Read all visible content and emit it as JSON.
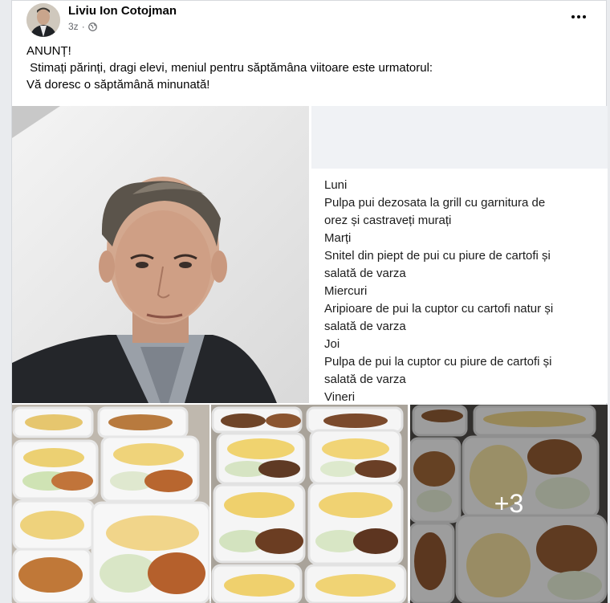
{
  "post": {
    "author": "Liviu Ion Cotojman",
    "time": "3z",
    "privacy_icon": "globe-icon",
    "text_lines": [
      "ANUNȚ!",
      " Stimați părinți, dragi elevi, meniul pentru săptămâna viitoare este urmatorul:",
      "Vă doresc o săptămână minunată!"
    ]
  },
  "menu_image": {
    "lines": [
      "Luni",
      "Pulpa pui dezosata la grill cu garnitura de",
      "orez și castraveți murați",
      "Marți",
      "Snitel din piept de pui cu piure de cartofi și",
      "salată de varza",
      "Miercuri",
      "Aripioare de pui la cuptor cu cartofi natur și",
      "salată de varza",
      "Joi",
      "Pulpa de pui la cuptor cu piure de cartofi și",
      "salată de varza",
      "Vineri"
    ]
  },
  "gallery": {
    "more_count": "+3"
  }
}
